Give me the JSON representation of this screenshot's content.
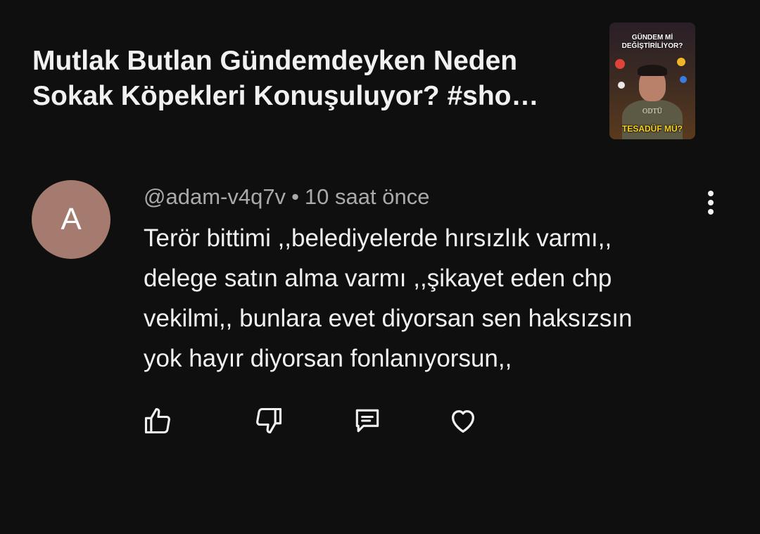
{
  "video": {
    "title_line1": "Mutlak Butlan Gündemdeyken Neden",
    "title_line2": "Sokak Köpekleri Konuşuluyor? #sho…",
    "thumbnail": {
      "top_text_line1": "GÜNDEM Mİ",
      "top_text_line2": "DEĞİŞTİRİLİYOR?",
      "shirt_text": "ODTÜ",
      "bottom_text": "TESADÜF MÜ?"
    }
  },
  "comment": {
    "avatar_letter": "A",
    "avatar_color": "#a47b6e",
    "author": "@adam-v4q7v",
    "separator": "•",
    "time": "10 saat önce",
    "text_lines": [
      "Terör bittimi ,,belediyelerde hırsızlık varmı,,",
      "delege satın alma varmı ,,şikayet eden chp",
      "vekilmi,, bunlara evet diyorsan sen haksızsın",
      "yok hayır diyorsan fonlanıyorsun,,"
    ]
  },
  "actions": {
    "like_icon": "thumbs-up-icon",
    "dislike_icon": "thumbs-down-icon",
    "reply_icon": "comment-icon",
    "heart_icon": "heart-icon",
    "more_icon": "more-vertical-icon"
  },
  "colors": {
    "background": "#0f0f0f",
    "primary_text": "#f1f1f1",
    "secondary_text": "#aaaaaa",
    "thumbnail_accent": "#ffd21a"
  }
}
